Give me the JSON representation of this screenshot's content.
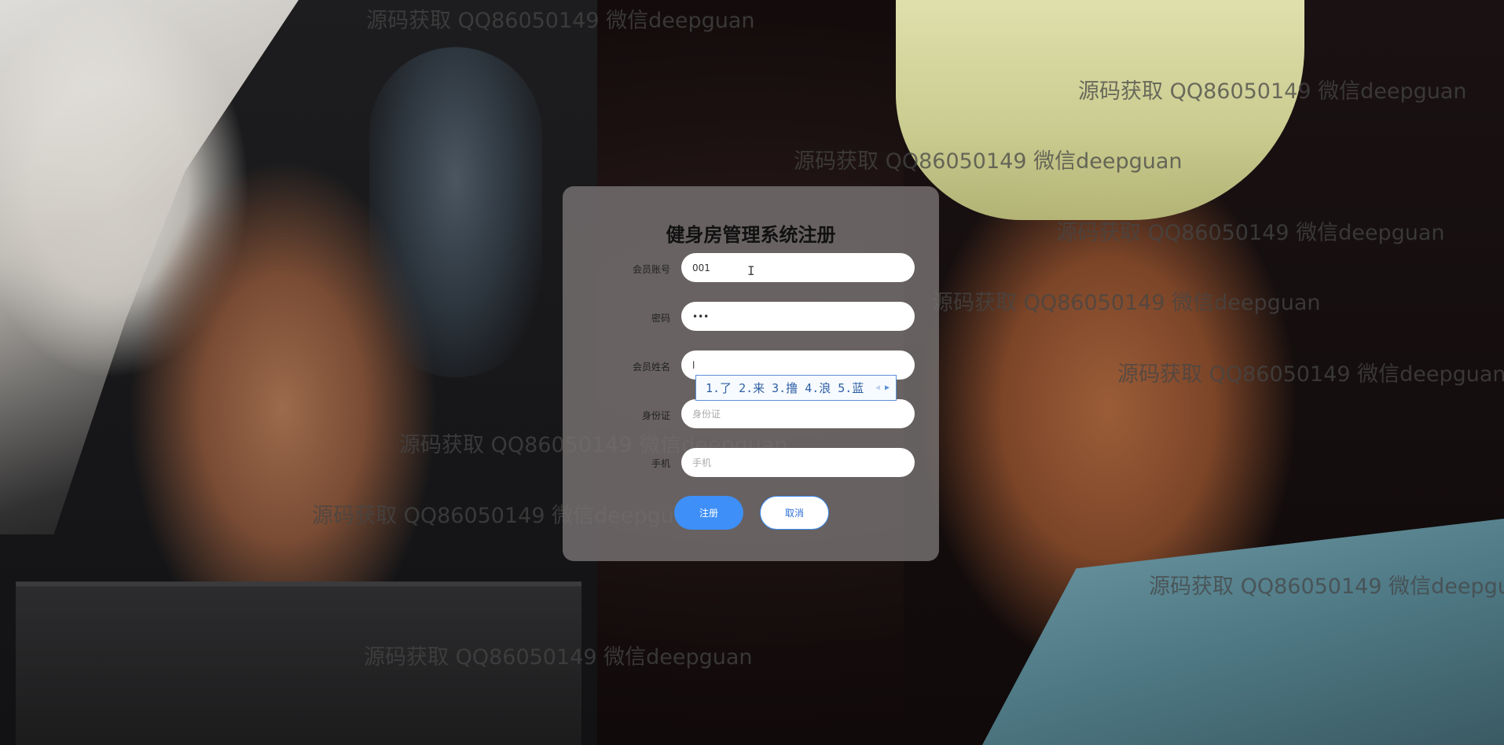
{
  "watermarks": [
    "源码获取 QQ86050149 微信deepguan",
    "源码获取 QQ86050149 微信deepguan",
    "源码获取 QQ86050149 微信deepguan",
    "源码获取 QQ86050149 微信deepguan",
    "源码获取 QQ86050149 微信deepguan",
    "源码获取 QQ86050149 微信deepguan",
    "源码获取 QQ86050149 微信deepguan",
    "源码获取 QQ86050149 微信deepguan",
    "源码获取 QQ86050149 微信deepguan",
    "源码获取 QQ86050149 微信deepguan"
  ],
  "form": {
    "title": "健身房管理系统注册",
    "fields": [
      {
        "label": "会员账号",
        "value": "001",
        "placeholder": ""
      },
      {
        "label": "密码",
        "value": "•••",
        "placeholder": ""
      },
      {
        "label": "会员姓名",
        "value": "l",
        "placeholder": ""
      },
      {
        "label": "身份证",
        "value": "",
        "placeholder": "身份证"
      },
      {
        "label": "手机",
        "value": "",
        "placeholder": "手机"
      }
    ],
    "submit_label": "注册",
    "cancel_label": "取消"
  },
  "ime": {
    "candidates": [
      "1.了",
      "2.来",
      "3.撸",
      "4.浪",
      "5.蓝"
    ],
    "prev_icon": "triangle-left-icon",
    "next_icon": "triangle-right-icon"
  },
  "colors": {
    "panel": "#78737380",
    "primary": "#3e8ff7",
    "ime_border": "#5c90d6"
  }
}
